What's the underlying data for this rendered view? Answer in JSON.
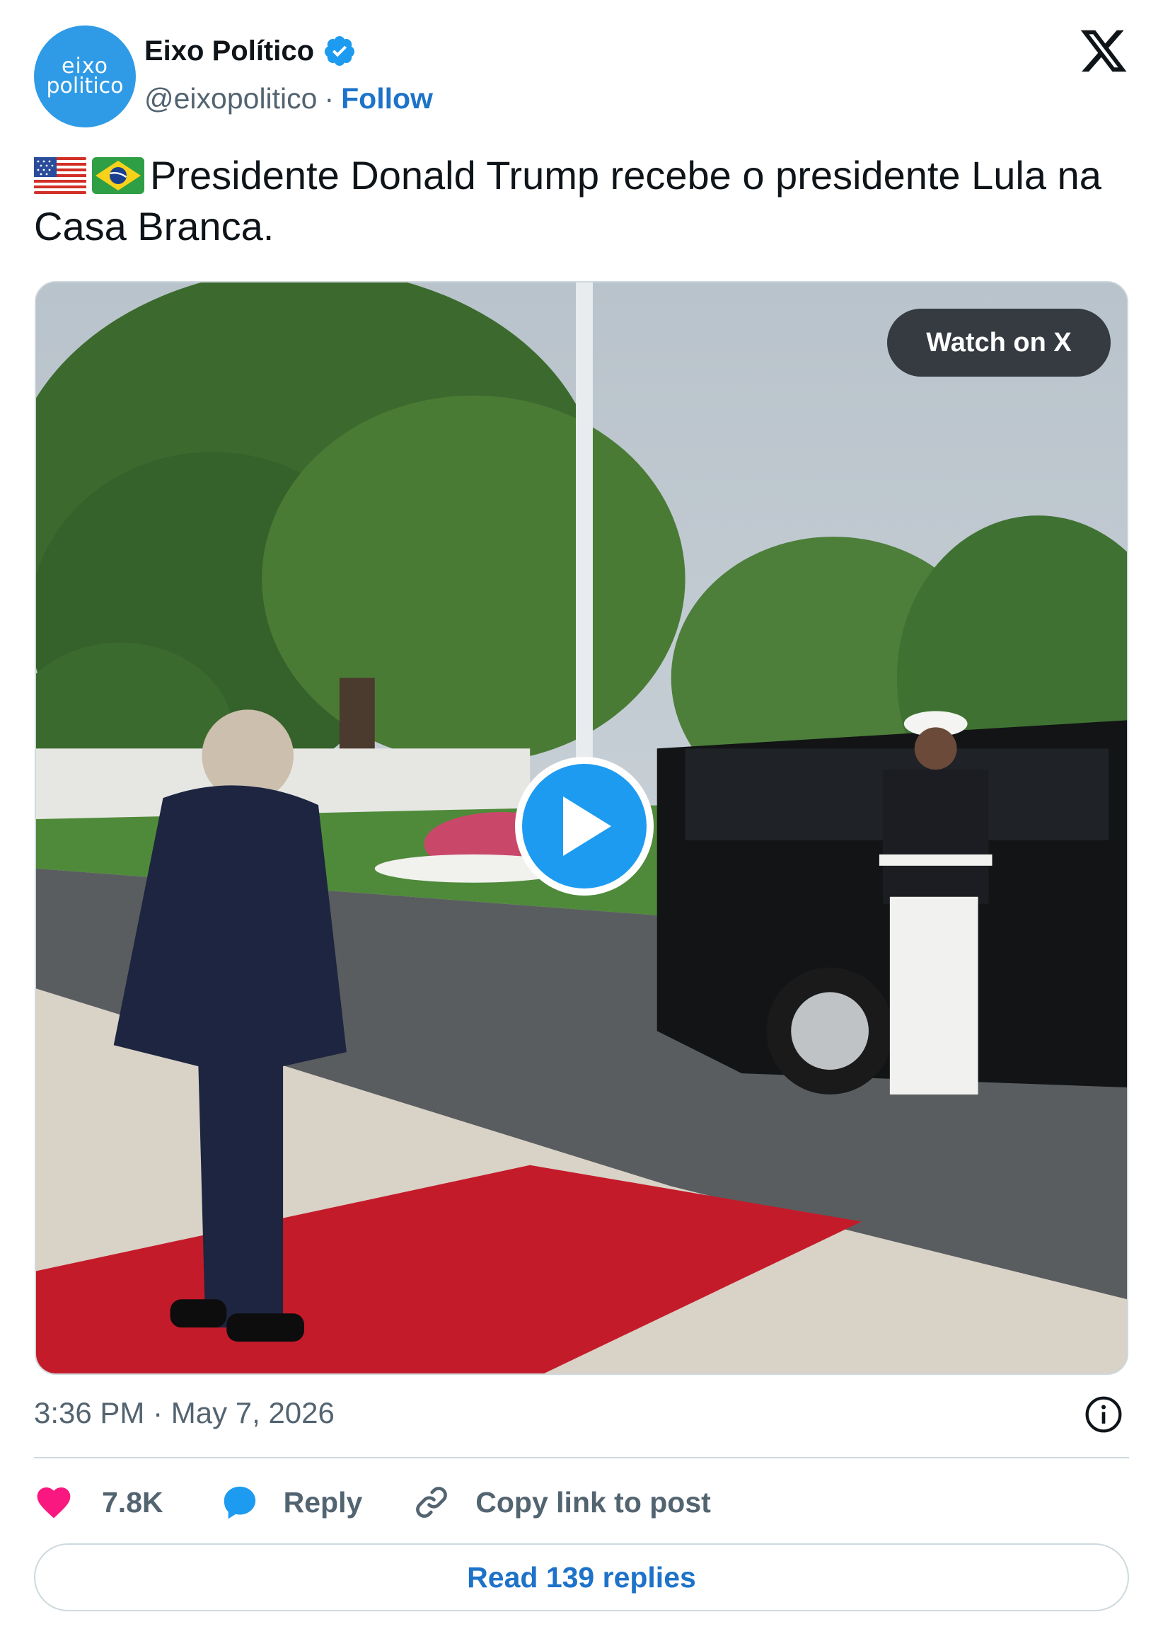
{
  "author": {
    "name": "Eixo Político",
    "handle": "@eixopolitico",
    "separator": "·",
    "follow_label": "Follow",
    "avatar_line1": "eixo",
    "avatar_line2": "politico",
    "avatar_color": "#2f9be6",
    "verified_icon": "verified-badge-icon"
  },
  "post": {
    "flags": [
      "us-flag-icon",
      "brazil-flag-icon"
    ],
    "text": "Presidente Donald Trump recebe o presidente Lula na Casa Branca."
  },
  "media": {
    "watch_label": "Watch on X",
    "play_icon": "play-icon"
  },
  "meta": {
    "timestamp": "3:36 PM · May 7, 2026",
    "info_icon": "info-icon"
  },
  "actions": {
    "like_count": "7.8K",
    "reply_label": "Reply",
    "copy_label": "Copy link to post"
  },
  "read_replies_label": "Read 139 replies",
  "colors": {
    "link": "#1d72c9",
    "accent": "#1d9bf0",
    "like": "#f91880",
    "muted": "#536471",
    "border": "#cfd9de"
  }
}
